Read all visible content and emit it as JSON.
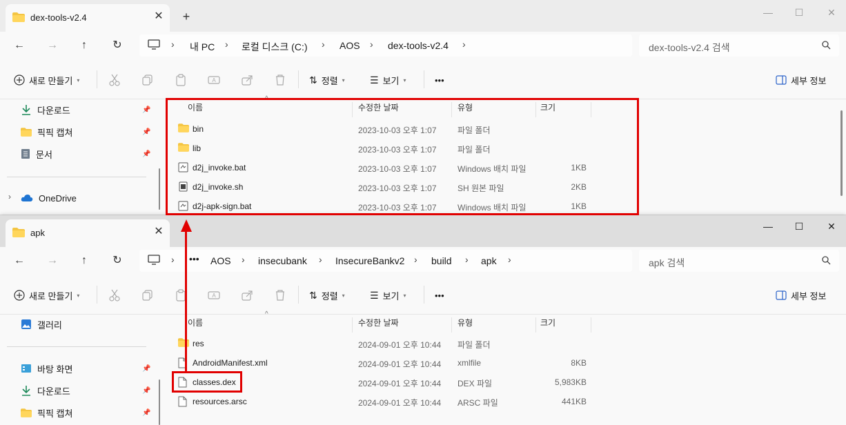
{
  "top_window": {
    "tab_title": "dex-tools-v2.4",
    "new_tab": "+",
    "window_controls": [
      "—",
      "☐",
      "✕"
    ],
    "breadcrumbs": [
      "내 PC",
      "로컬 디스크 (C:)",
      "AOS",
      "dex-tools-v2.4"
    ],
    "search_placeholder": "dex-tools-v2.4 검색",
    "toolbar": {
      "new": "새로 만들기",
      "sort": "정렬",
      "view": "보기",
      "more": "•••",
      "details": "세부 정보"
    },
    "sidebar": [
      {
        "label": "다운로드",
        "icon": "download-icon",
        "pinned": true
      },
      {
        "label": "픽픽 캡쳐",
        "icon": "folder-icon",
        "pinned": true
      },
      {
        "label": "문서",
        "icon": "document-icon",
        "pinned": true
      },
      {
        "label": "OneDrive",
        "icon": "cloud-icon",
        "pinned": false
      }
    ],
    "columns": {
      "name": "이름",
      "date": "수정한 날짜",
      "type": "유형",
      "size": "크기"
    },
    "files": [
      {
        "name": "bin",
        "date": "2023-10-03 오후 1:07",
        "type": "파일 폴더",
        "size": "",
        "icon": "folder-icon"
      },
      {
        "name": "lib",
        "date": "2023-10-03 오후 1:07",
        "type": "파일 폴더",
        "size": "",
        "icon": "folder-icon"
      },
      {
        "name": "d2j_invoke.bat",
        "date": "2023-10-03 오후 1:07",
        "type": "Windows 배치 파일",
        "size": "1KB",
        "icon": "batch-file-icon"
      },
      {
        "name": "d2j_invoke.sh",
        "date": "2023-10-03 오후 1:07",
        "type": "SH 원본 파일",
        "size": "2KB",
        "icon": "script-file-icon"
      },
      {
        "name": "d2j-apk-sign.bat",
        "date": "2023-10-03 오후 1:07",
        "type": "Windows 배치 파일",
        "size": "1KB",
        "icon": "batch-file-icon"
      }
    ]
  },
  "bottom_window": {
    "tab_title": "apk",
    "window_controls": [
      "—",
      "☐",
      "✕"
    ],
    "breadcrumbs": [
      "•••",
      "AOS",
      "insecubank",
      "InsecureBankv2",
      "build",
      "apk"
    ],
    "search_placeholder": "apk 검색",
    "toolbar": {
      "new": "새로 만들기",
      "sort": "정렬",
      "view": "보기",
      "more": "•••",
      "details": "세부 정보"
    },
    "sidebar": [
      {
        "label": "갤러리",
        "icon": "gallery-icon",
        "pinned": false
      },
      {
        "label": "바탕 화면",
        "icon": "desktop-icon",
        "pinned": true
      },
      {
        "label": "다운로드",
        "icon": "download-icon",
        "pinned": true
      },
      {
        "label": "픽픽 캡쳐",
        "icon": "folder-icon",
        "pinned": true
      }
    ],
    "columns": {
      "name": "이름",
      "date": "수정한 날짜",
      "type": "유형",
      "size": "크기"
    },
    "files": [
      {
        "name": "res",
        "date": "2024-09-01 오후 10:44",
        "type": "파일 폴더",
        "size": "",
        "icon": "folder-icon"
      },
      {
        "name": "AndroidManifest.xml",
        "date": "2024-09-01 오후 10:44",
        "type": "xmlfile",
        "size": "8KB",
        "icon": "file-icon"
      },
      {
        "name": "classes.dex",
        "date": "2024-09-01 오후 10:44",
        "type": "DEX 파일",
        "size": "5,983KB",
        "icon": "file-icon"
      },
      {
        "name": "resources.arsc",
        "date": "2024-09-01 오후 10:44",
        "type": "ARSC 파일",
        "size": "441KB",
        "icon": "file-icon"
      }
    ]
  },
  "annotations": {
    "color": "#e10000",
    "highlighted_file": "classes.dex"
  }
}
